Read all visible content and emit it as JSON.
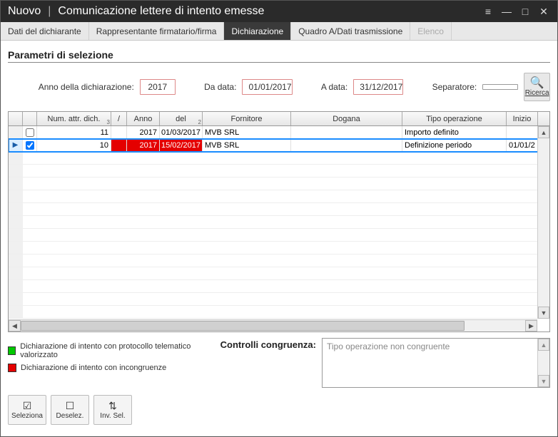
{
  "titlebar": {
    "new": "Nuovo",
    "main": "Comunicazione lettere di intento emesse"
  },
  "tabs": [
    {
      "label": "Dati del dichiarante",
      "state": "normal"
    },
    {
      "label": "Rappresentante firmatario/firma",
      "state": "normal"
    },
    {
      "label": "Dichiarazione",
      "state": "active"
    },
    {
      "label": "Quadro A/Dati trasmissione",
      "state": "normal"
    },
    {
      "label": "Elenco",
      "state": "disabled"
    }
  ],
  "params": {
    "heading": "Parametri di selezione",
    "year_label": "Anno della dichiarazione:",
    "year_value": "2017",
    "from_label": "Da data:",
    "from_value": "01/01/2017",
    "to_label": "A data:",
    "to_value": "31/12/2017",
    "sep_label": "Separatore:",
    "sep_value": "",
    "search_label": "Ricerca"
  },
  "grid": {
    "columns": {
      "num": "Num. attr. dich.",
      "num_corner": "3",
      "slash": "/",
      "anno": "Anno",
      "del": "del",
      "del_corner": "2",
      "fornitore": "Fornitore",
      "dogana": "Dogana",
      "tipo": "Tipo operazione",
      "inizio": "Inizio"
    },
    "rows": [
      {
        "checked": false,
        "selected": false,
        "num": "11",
        "slash": "",
        "anno": "2017",
        "del": "01/03/2017",
        "fornitore": "MVB SRL",
        "dogana": "",
        "tipo": "Importo definito",
        "inizio": "",
        "anno_red": false,
        "del_red": false
      },
      {
        "checked": true,
        "selected": true,
        "num": "10",
        "slash": "",
        "anno": "2017",
        "del": "15/02/2017",
        "fornitore": "MVB SRL",
        "dogana": "",
        "tipo": "Definizione periodo",
        "inizio": "01/01/2",
        "anno_red": true,
        "del_red": true
      }
    ]
  },
  "congruenza": {
    "label": "Controlli congruenza:",
    "text": "Tipo operazione non congruente"
  },
  "legend": {
    "green": "Dichiarazione di intento con protocollo telematico valorizzato",
    "red": "Dichiarazione di intento con incongruenze"
  },
  "toolbar": {
    "seleziona": "Seleziona",
    "deselez": "Deselez.",
    "inv_sel": "Inv. Sel."
  }
}
